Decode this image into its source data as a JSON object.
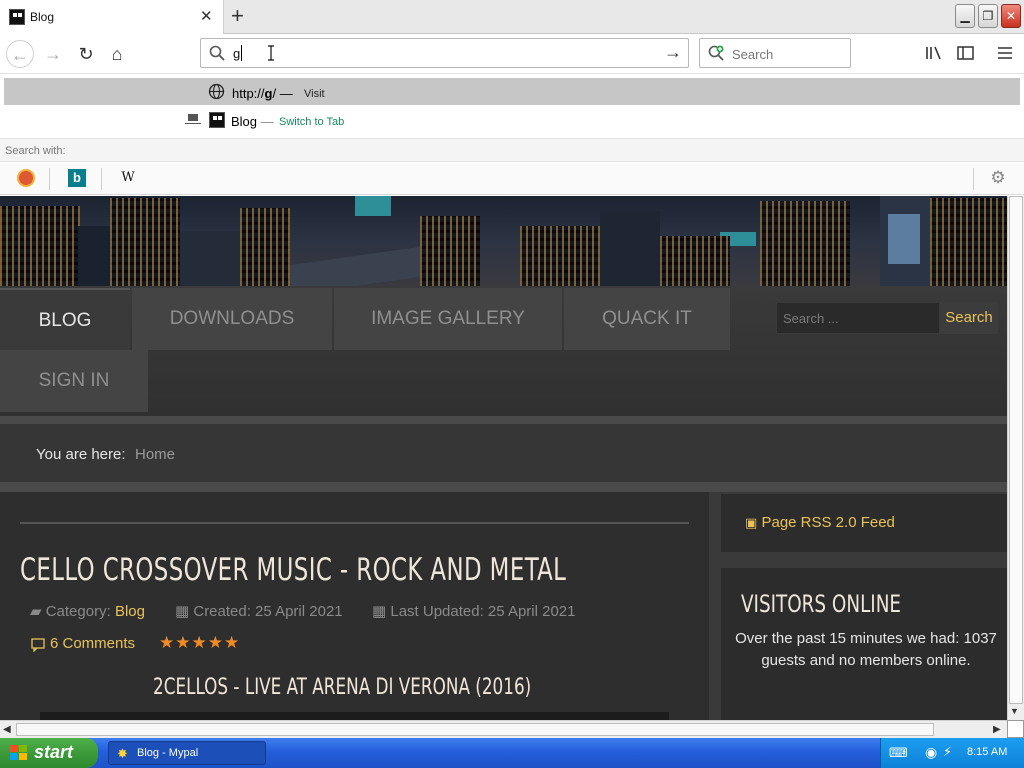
{
  "browser": {
    "tab_title": "Blog",
    "url_value": "g",
    "search_placeholder": "Search"
  },
  "dropdown": {
    "row1_url_prefix": "http://",
    "row1_url_bold": "g",
    "row1_url_suffix": "/",
    "row1_sep": "—",
    "row1_action": "Visit",
    "row2_title": "Blog",
    "row2_sep": "—",
    "row2_action": "Switch to Tab",
    "search_with": "Search with:"
  },
  "site": {
    "menu": [
      "BLOG",
      "DOWNLOADS",
      "IMAGE GALLERY",
      "QUACK IT",
      "SIGN IN"
    ],
    "search_placeholder": "Search ...",
    "search_button": "Search",
    "breadcrumb_label": "You are here:",
    "breadcrumb_home": "Home",
    "article": {
      "title": "CELLO CROSSOVER MUSIC - ROCK AND METAL",
      "category_label": "Category:",
      "category": "Blog",
      "created": "Created: 25 April 2021",
      "updated": "Last Updated: 25 April 2021",
      "comments": "6 Comments",
      "stars": "★★★★★",
      "video_title": "2CELLOS - LIVE AT ARENA DI VERONA (2016)"
    },
    "sidebar": {
      "rss": "Page RSS 2.0 Feed",
      "visitors_title": "VISITORS ONLINE",
      "visitors_text": "Over the past 15 minutes we had: 1037 guests and no members online."
    }
  },
  "taskbar": {
    "start": "start",
    "task": "Blog - Mypal",
    "clock": "8:15 AM"
  }
}
